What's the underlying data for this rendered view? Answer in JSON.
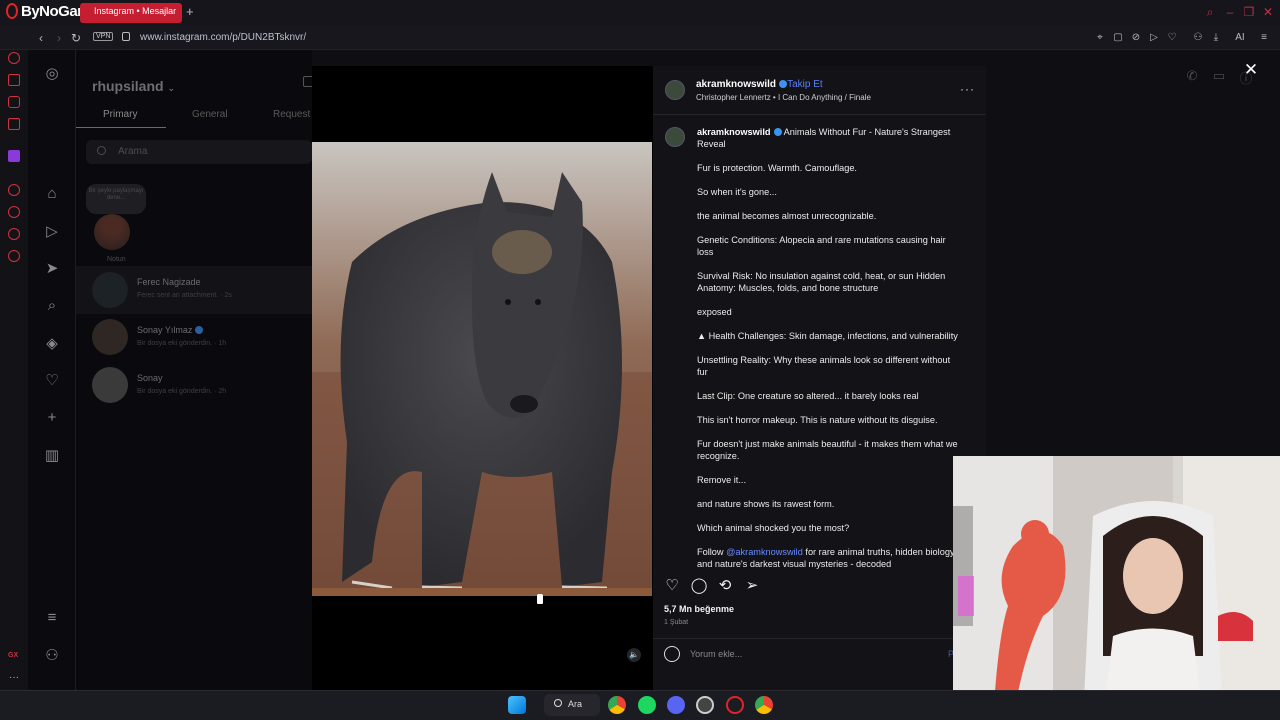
{
  "browser": {
    "brand": "ByNoGame",
    "tab_title": "Instagram • Mesajlar",
    "new_tab": "+",
    "url": "www.instagram.com/p/DUN2BTsknvr/",
    "vpn_label": "VPN",
    "ai_label": "AI"
  },
  "inbox": {
    "username": "rhupsiland",
    "tabs": [
      "Primary",
      "General",
      "Request"
    ],
    "search_placeholder": "Arama",
    "note_bubble": "Bir şeyle paylaşmayı dene...",
    "note_label": "Notun",
    "conversations": [
      {
        "name": "Ferec Nagizade",
        "preview": "Ferec sent an attachment. · 2s"
      },
      {
        "name": "Sonay Yılmaz",
        "preview": "Bir dosya eki gönderdin. · 1h"
      },
      {
        "name": "Sonay",
        "preview": "Bir dosya eki gönderdin. · 2h"
      }
    ]
  },
  "post": {
    "username": "akramknowswild",
    "follow_label": "Takip Et",
    "audio": "Christopher Lennertz • I Can Do Anything / Finale",
    "caption_title": "Animals Without Fur - Nature's Strangest Reveal",
    "caption_lines": [
      "Fur is protection. Warmth. Camouflage.",
      "So when it's gone...",
      "the animal becomes almost unrecognizable.",
      "Genetic Conditions: Alopecia and rare mutations causing hair loss",
      "Survival Risk: No insulation against cold, heat, or sun Hidden Anatomy: Muscles, folds, and bone structure",
      "exposed",
      "▲ Health Challenges: Skin damage, infections, and vulnerability",
      "Unsettling Reality: Why these animals look so different without fur",
      "Last Clip: One creature so altered... it barely looks real",
      "This isn't horror makeup. This is nature without its disguise.",
      "Fur doesn't just make animals beautiful - it makes them what we recognize.",
      "Remove it...",
      "and nature shows its rawest form.",
      "Which animal shocked you the most?"
    ],
    "follow_line_prefix": "Follow ",
    "follow_line_mention": "@akramknowswild",
    "follow_line_suffix": " for rare animal truths, hidden biology and nature's darkest visual mysteries - decoded",
    "likes": "5,7 Mn beğenme",
    "date": "1 Şubat",
    "comment_placeholder": "Yorum ekle...",
    "post_button": "P"
  },
  "taskbar": {
    "search_label": "Ara"
  },
  "colors": {
    "accent_red": "#c61e31",
    "instagram_blue": "#3797f0",
    "mention_blue": "#6c8cff"
  }
}
